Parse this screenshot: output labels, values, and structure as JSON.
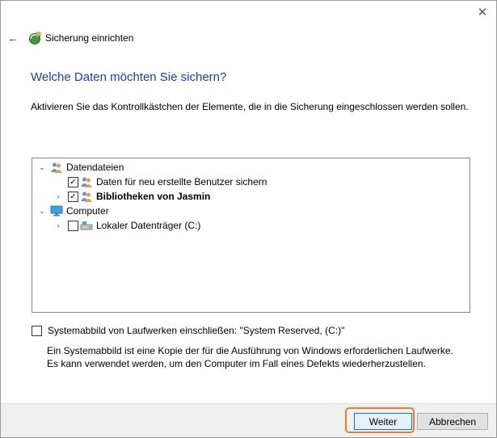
{
  "window": {
    "title": "Sicherung einrichten",
    "close_glyph": "✕"
  },
  "nav": {
    "back_glyph": "←"
  },
  "heading": "Welche Daten möchten Sie sichern?",
  "instruction": "Aktivieren Sie das Kontrollkästchen der Elemente, die in die Sicherung eingeschlossen werden sollen.",
  "tree": {
    "items": [
      {
        "label": "Datendateien",
        "expanded": true,
        "checkbox": false,
        "icon": "users-icon"
      },
      {
        "label": "Daten für neu erstellte Benutzer sichern",
        "checked": true,
        "icon": "users-icon"
      },
      {
        "label": "Bibliotheken von Jasmin",
        "checked": true,
        "expanded": false,
        "bold": true,
        "icon": "users-icon"
      },
      {
        "label": "Computer",
        "expanded": true,
        "checkbox": false,
        "icon": "computer-icon"
      },
      {
        "label": "Lokaler Datenträger (C:)",
        "checked": false,
        "expanded": false,
        "icon": "drive-icon"
      }
    ],
    "check_glyph": "✓",
    "expanded_glyph": "⌄",
    "collapsed_glyph": "›"
  },
  "system_image": {
    "label": "Systemabbild von Laufwerken einschließen: \"System Reserved, (C:)\"",
    "checked": false,
    "description": "Ein Systemabbild ist eine Kopie der für die Ausführung von Windows erforderlichen Laufwerke. Es kann verwendet werden, um den Computer im Fall eines Defekts wiederherzustellen."
  },
  "buttons": {
    "next": "Weiter",
    "cancel": "Abbrechen"
  },
  "colors": {
    "heading": "#1c3fa3",
    "highlight": "#f07a2a",
    "primary_border": "#0078d7"
  }
}
